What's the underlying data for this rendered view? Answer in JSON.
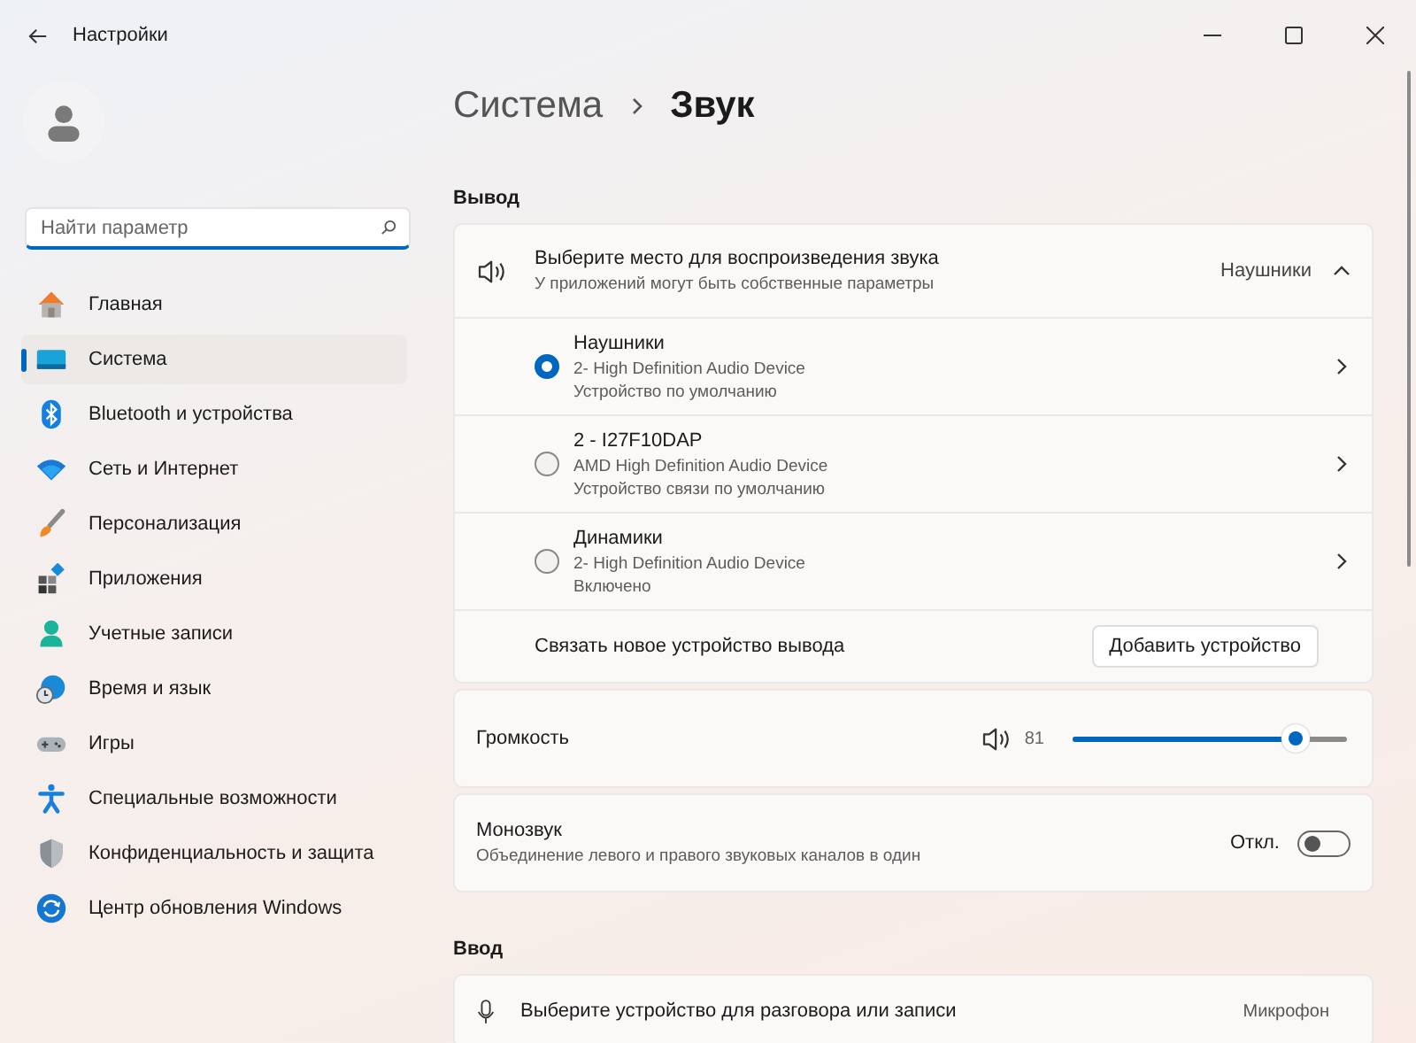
{
  "window": {
    "title": "Настройки"
  },
  "search": {
    "placeholder": "Найти параметр"
  },
  "sidebar": {
    "items": [
      {
        "label": "Главная",
        "selected": false
      },
      {
        "label": "Система",
        "selected": true
      },
      {
        "label": "Bluetooth и устройства",
        "selected": false
      },
      {
        "label": "Сеть и Интернет",
        "selected": false
      },
      {
        "label": "Персонализация",
        "selected": false
      },
      {
        "label": "Приложения",
        "selected": false
      },
      {
        "label": "Учетные записи",
        "selected": false
      },
      {
        "label": "Время и язык",
        "selected": false
      },
      {
        "label": "Игры",
        "selected": false
      },
      {
        "label": "Специальные возможности",
        "selected": false
      },
      {
        "label": "Конфиденциальность и защита",
        "selected": false
      },
      {
        "label": "Центр обновления Windows",
        "selected": false
      }
    ]
  },
  "breadcrumb": [
    "Система",
    "Звук"
  ],
  "output": {
    "heading": "Вывод",
    "chooser": {
      "title": "Выберите место для воспроизведения звука",
      "subtitle": "У приложений могут быть собственные параметры",
      "value": "Наушники",
      "expanded": true
    },
    "devices": [
      {
        "name": "Наушники",
        "driver": "2- High Definition Audio Device",
        "status": "Устройство по умолчанию",
        "selected": true
      },
      {
        "name": "2 - I27F10DAP",
        "driver": "AMD High Definition Audio Device",
        "status": "Устройство связи по умолчанию",
        "selected": false
      },
      {
        "name": "Динамики",
        "driver": "2- High Definition Audio Device",
        "status": "Включено",
        "selected": false
      }
    ],
    "pair": {
      "label": "Связать новое устройство вывода",
      "button": "Добавить устройство"
    },
    "volume": {
      "label": "Громкость",
      "reading": "81",
      "level": 0.81
    },
    "mono": {
      "title": "Монозвук",
      "subtitle": "Объединение левого и правого звуковых каналов в один",
      "state_label": "Откл.",
      "on": false
    }
  },
  "input": {
    "heading": "Ввод",
    "chooser": {
      "title": "Выберите устройство для разговора или записи",
      "value": "Микрофон"
    }
  }
}
